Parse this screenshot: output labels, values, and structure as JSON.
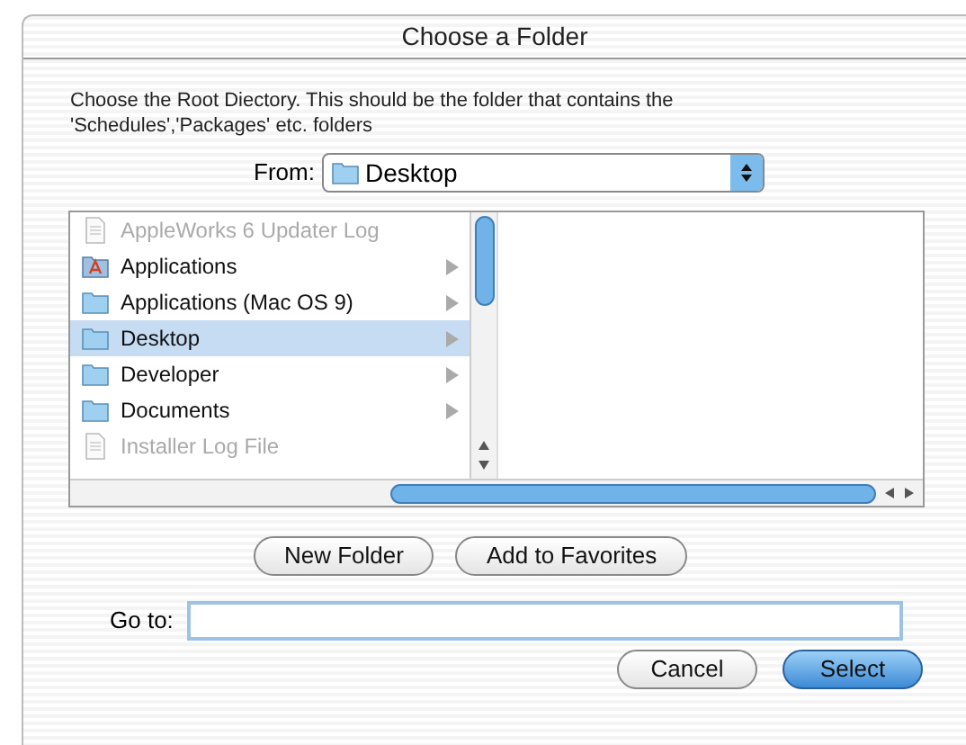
{
  "window": {
    "title": "Choose a Folder"
  },
  "message": "Choose the Root Diectory. This should be the folder that contains the 'Schedules','Packages' etc. folders",
  "from": {
    "label": "From:",
    "value": "Desktop"
  },
  "items": [
    {
      "name": "AppleWorks 6 Updater Log",
      "kind": "document",
      "disabled": true,
      "selected": false,
      "has_children": false
    },
    {
      "name": "Applications",
      "kind": "app",
      "disabled": false,
      "selected": false,
      "has_children": true
    },
    {
      "name": "Applications (Mac OS 9)",
      "kind": "folder",
      "disabled": false,
      "selected": false,
      "has_children": true
    },
    {
      "name": "Desktop",
      "kind": "folder",
      "disabled": false,
      "selected": true,
      "has_children": true
    },
    {
      "name": "Developer",
      "kind": "folder",
      "disabled": false,
      "selected": false,
      "has_children": true
    },
    {
      "name": "Documents",
      "kind": "folder",
      "disabled": false,
      "selected": false,
      "has_children": true
    },
    {
      "name": "Installer Log File",
      "kind": "document",
      "disabled": true,
      "selected": false,
      "has_children": false
    }
  ],
  "buttons": [
    "New Folder",
    "Add to Favorites"
  ],
  "goto": {
    "label": "Go to:"
  },
  "actions": [
    {
      "label": "Cancel",
      "default": false
    },
    {
      "label": "Select",
      "default": true
    }
  ]
}
